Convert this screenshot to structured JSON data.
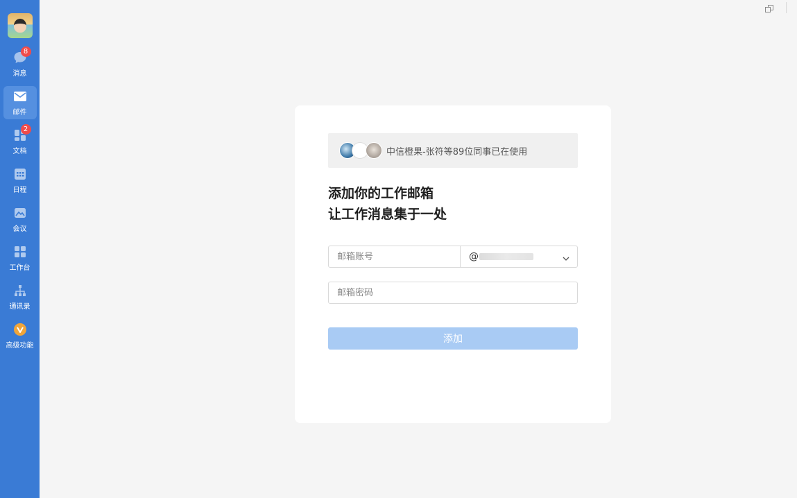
{
  "sidebar": {
    "items": [
      {
        "label": "消息",
        "badge": "8",
        "icon": "chat-icon"
      },
      {
        "label": "邮件",
        "badge": "",
        "icon": "mail-icon",
        "active": true
      },
      {
        "label": "文档",
        "badge": "2",
        "icon": "doc-icon"
      },
      {
        "label": "日程",
        "badge": "",
        "icon": "calendar-icon"
      },
      {
        "label": "会议",
        "badge": "",
        "icon": "meeting-icon"
      },
      {
        "label": "工作台",
        "badge": "",
        "icon": "workbench-icon"
      },
      {
        "label": "通讯录",
        "badge": "",
        "icon": "contacts-icon"
      },
      {
        "label": "高级功能",
        "badge": "",
        "icon": "premium-icon"
      }
    ]
  },
  "card": {
    "colleagues_text": "中信橙果-张符等89位同事已在使用",
    "headline_line1": "添加你的工作邮箱",
    "headline_line2": "让工作消息集于一处",
    "account_placeholder": "邮箱账号",
    "domain_prefix": "@",
    "password_placeholder": "邮箱密码",
    "add_label": "添加"
  },
  "colors": {
    "sidebar": "#3a7bd5",
    "sidebar_active": "#5590e0",
    "badge": "#f04b4b",
    "button_disabled": "#a9cbf4",
    "background": "#f5f5f5"
  }
}
